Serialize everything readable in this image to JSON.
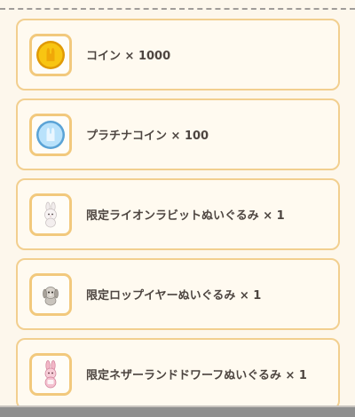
{
  "rewards": [
    {
      "name": "コイン × 1000",
      "icon": "gold-coin-icon"
    },
    {
      "name": "プラチナコイン × 100",
      "icon": "platinum-coin-icon"
    },
    {
      "name": "限定ライオンラビットぬいぐるみ × 1",
      "icon": "lionhead-rabbit-plush-icon"
    },
    {
      "name": "限定ロップイヤーぬいぐるみ × 1",
      "icon": "lop-ear-rabbit-plush-icon"
    },
    {
      "name": "限定ネザーランドドワーフぬいぐるみ × 1",
      "icon": "netherland-dwarf-plush-icon"
    }
  ],
  "colors": {
    "background": "#fdf7ec",
    "card_border": "#f2cf8f",
    "gold_coin": "#f6bf0e",
    "platinum_coin": "#9fd3f5",
    "text": "#4d4540"
  }
}
